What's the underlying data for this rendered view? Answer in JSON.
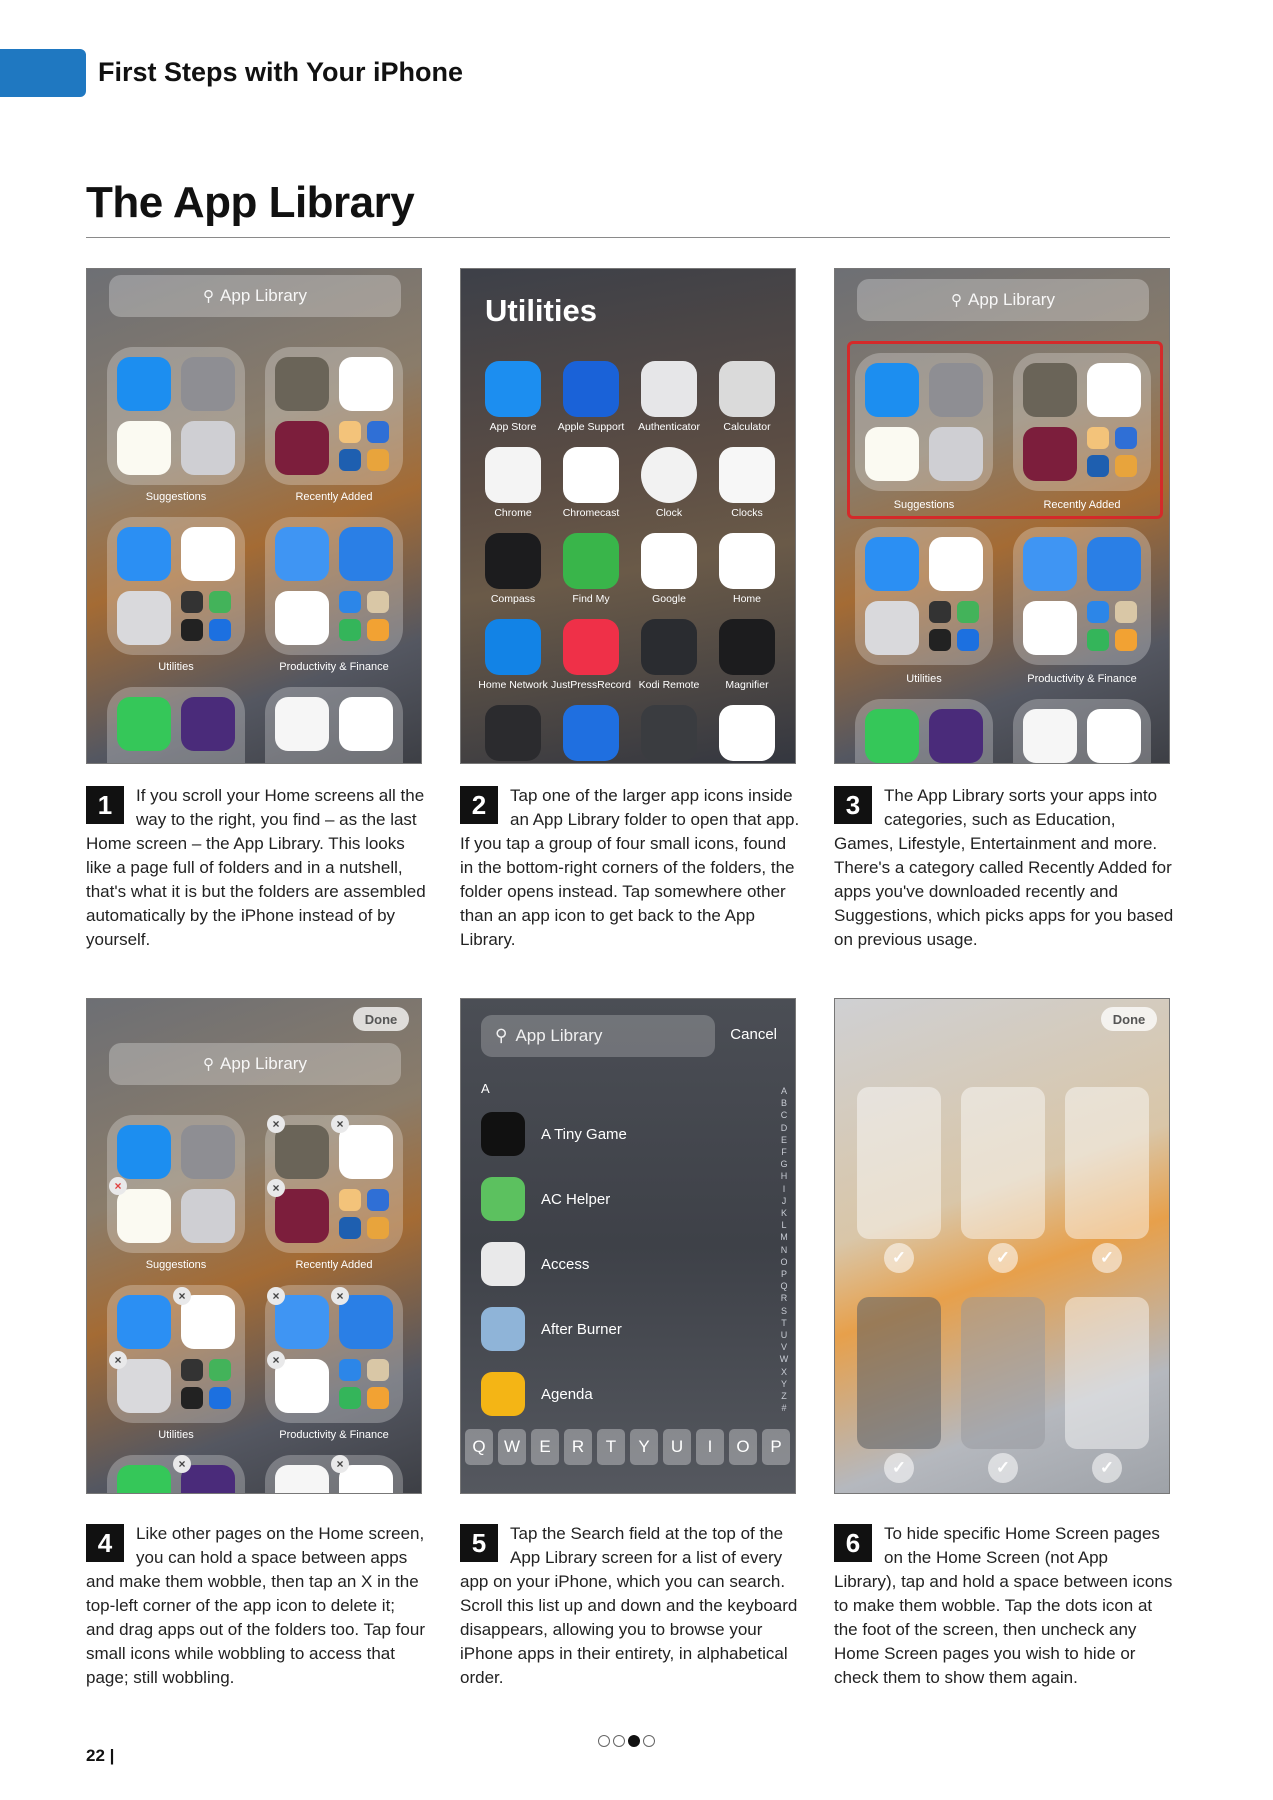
{
  "header": {
    "section_title": "First Steps with Your iPhone"
  },
  "page": {
    "title": "The App Library",
    "number": "22  |"
  },
  "screens": {
    "search_label": "App Library",
    "folders": [
      "Suggestions",
      "Recently Added",
      "Utilities",
      "Productivity & Finance"
    ],
    "done": "Done",
    "utilities_title": "Utilities",
    "utility_apps": [
      "App Store",
      "Apple Support",
      "Authenticator",
      "Calculator",
      "Chrome",
      "Chromecast",
      "Clock",
      "Clocks",
      "Compass",
      "Find My",
      "Google",
      "Home",
      "Home Network",
      "JustPressRecord",
      "Kodi Remote",
      "Magnifier"
    ],
    "search_cancel": "Cancel",
    "list_section": "A",
    "list_apps": [
      "A Tiny Game",
      "AC Helper",
      "Access",
      "After Burner",
      "Agenda"
    ],
    "index_letters": "A\nB\nC\nD\nE\nF\nG\nH\nI\nJ\nK\nL\nM\nN\nO\nP\nQ\nR\nS\nT\nU\nV\nW\nX\nY\nZ\n#",
    "keyboard_row": [
      "Q",
      "W",
      "E",
      "R",
      "T",
      "Y",
      "U",
      "I",
      "O",
      "P"
    ]
  },
  "steps": [
    {
      "num": "1",
      "text": "If you scroll your Home screens all the way to the right, you find – as the last Home screen – the App Library. This looks like a page full of folders and in a nutshell, that's what it is but the folders are assembled automatically by the iPhone instead of by yourself."
    },
    {
      "num": "2",
      "text": "Tap one of the larger app icons inside an App Library folder to open that app. If you tap a group of four small icons, found in the bottom-right corners of the folders, the folder opens instead. Tap somewhere other than an app icon to get back to the App Library."
    },
    {
      "num": "3",
      "text": "The App Library sorts your apps into categories, such as Education, Games, Lifestyle, Entertainment and more. There's a category called Recently Added for apps you've downloaded recently and Suggestions, which picks apps for you based on previous usage."
    },
    {
      "num": "4",
      "text": "Like other pages on the Home screen, you can hold a space between apps and make them wobble, then tap an X in the top-left corner of the app icon to delete it; and drag apps out of the folders too. Tap four small icons while wobbling to access that page; still wobbling."
    },
    {
      "num": "5",
      "text": "Tap the Search field at the top of the App Library screen for a list of every app on your iPhone, which you can search. Scroll this list up and down and the keyboard disappears, allowing you to browse your iPhone apps in their entirety, in alphabetical order."
    },
    {
      "num": "6",
      "text": "To hide specific Home Screen pages on the Home Screen (not App Library), tap and hold a space between icons to make them wobble. Tap the dots icon at the foot of the screen, then uncheck any Home Screen pages you wish to hide or check them to show them again."
    }
  ]
}
